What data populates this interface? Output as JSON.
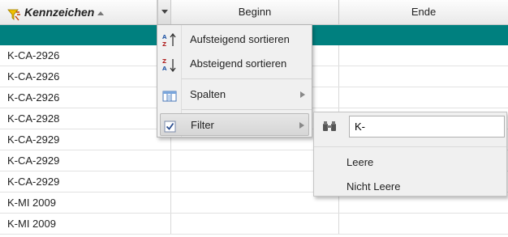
{
  "header": {
    "col1_label": "Kennzeichen",
    "col2_label": "Beginn",
    "col3_label": "Ende"
  },
  "colors": {
    "filter_row": "#00807f",
    "menu_bg": "#f0f0f0"
  },
  "rows": [
    {
      "kennzeichen": "K-CA-2926",
      "beginn": "",
      "ende": ""
    },
    {
      "kennzeichen": "K-CA-2926",
      "beginn": "",
      "ende": ""
    },
    {
      "kennzeichen": "K-CA-2926",
      "beginn": "",
      "ende": ""
    },
    {
      "kennzeichen": "K-CA-2928",
      "beginn": "",
      "ende": ""
    },
    {
      "kennzeichen": "K-CA-2929",
      "beginn": "",
      "ende": ""
    },
    {
      "kennzeichen": "K-CA-2929",
      "beginn": "",
      "ende": ""
    },
    {
      "kennzeichen": "K-CA-2929",
      "beginn": "",
      "ende": ""
    },
    {
      "kennzeichen": "K-MI 2009",
      "beginn": "",
      "ende": ""
    },
    {
      "kennzeichen": "K-MI 2009",
      "beginn": "",
      "ende": ""
    }
  ],
  "menu": {
    "sort_asc": "Aufsteigend sortieren",
    "sort_desc": "Absteigend sortieren",
    "columns": "Spalten",
    "filter": "Filter",
    "filter_checked": true
  },
  "filter_menu": {
    "value": "K-",
    "empty": "Leere",
    "not_empty": "Nicht Leere"
  }
}
